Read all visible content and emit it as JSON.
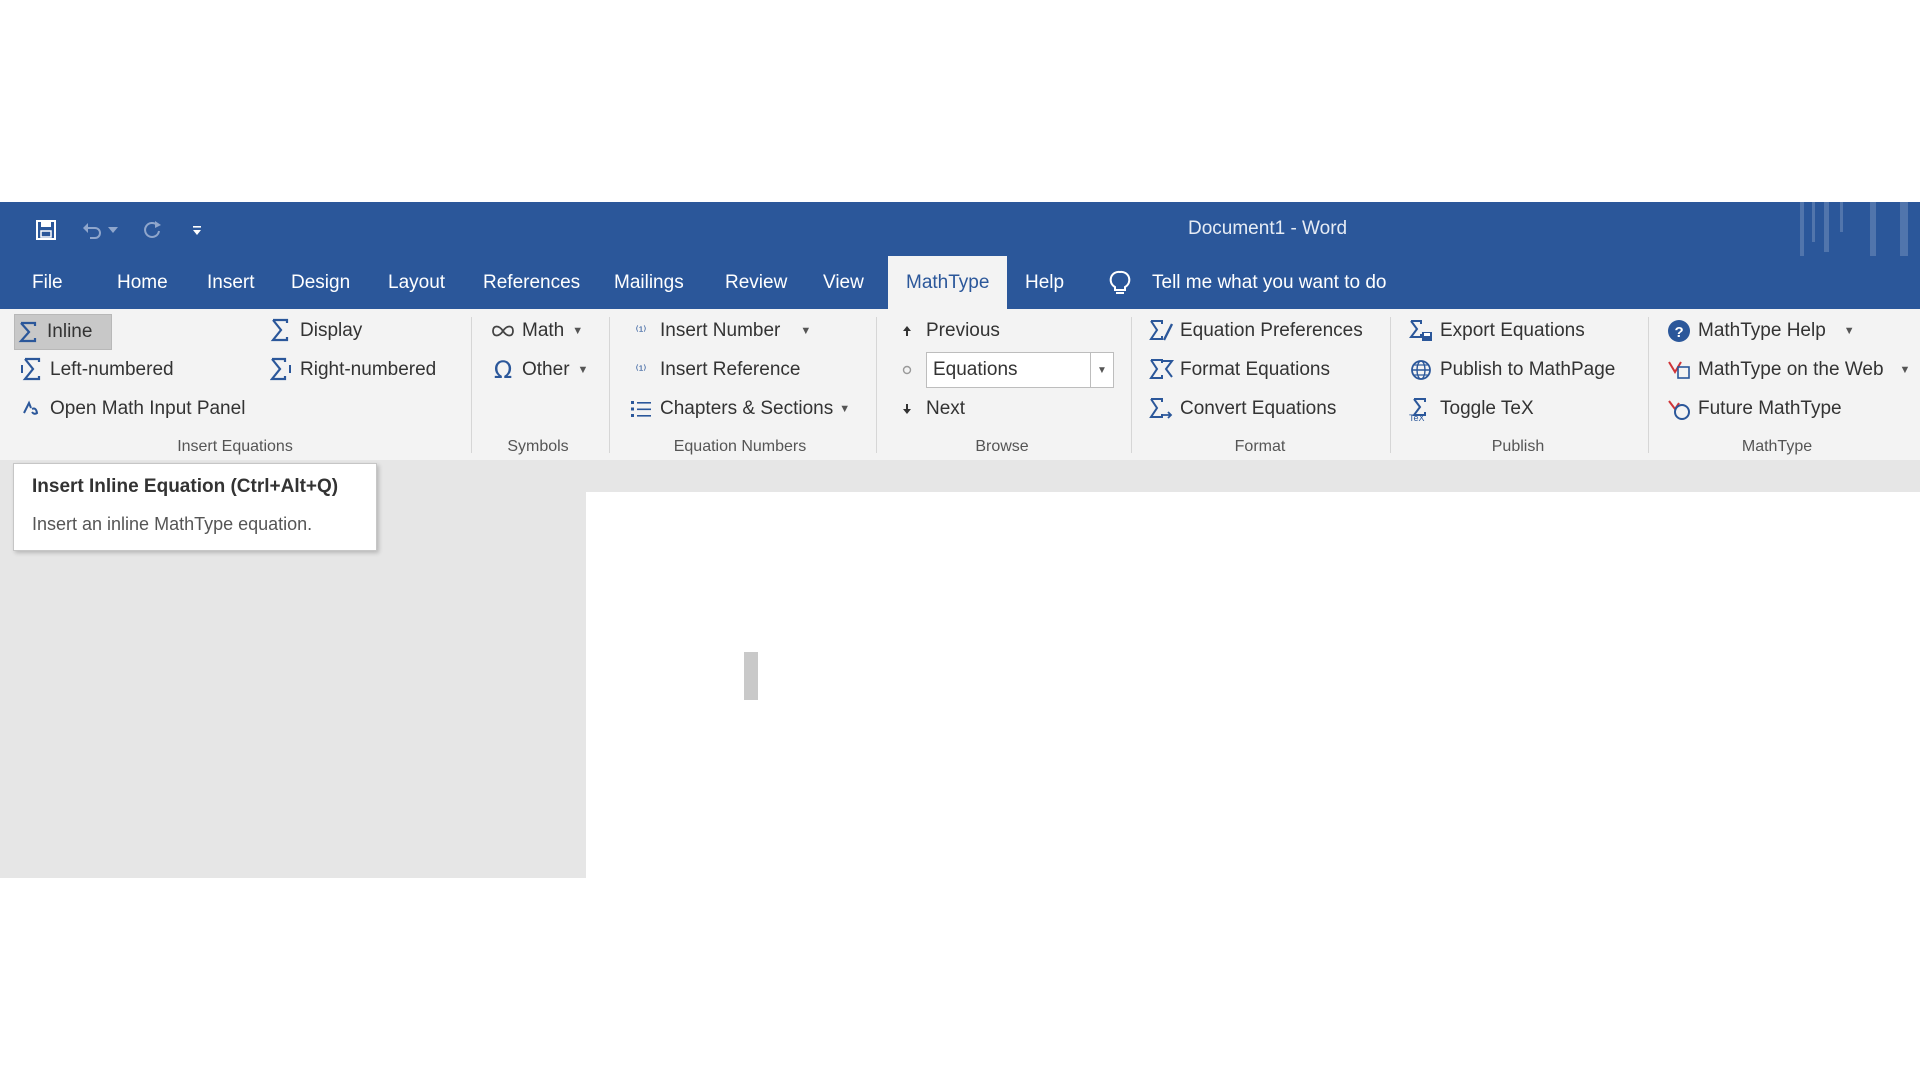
{
  "window": {
    "title": "Document1  -  Word",
    "quick_access": [
      "save-icon",
      "undo-icon",
      "redo-icon",
      "customize-icon"
    ]
  },
  "tabs": [
    "File",
    "Home",
    "Insert",
    "Design",
    "Layout",
    "References",
    "Mailings",
    "Review",
    "View",
    "MathType",
    "Help"
  ],
  "active_tab": "MathType",
  "tell_me": "Tell me what you want to do",
  "ribbon": {
    "insert_equations": {
      "label": "Insert Equations",
      "inline": "Inline",
      "display": "Display",
      "left_numbered": "Left-numbered",
      "right_numbered": "Right-numbered",
      "open_panel": "Open Math Input Panel"
    },
    "symbols": {
      "label": "Symbols",
      "math": "Math",
      "other": "Other"
    },
    "equation_numbers": {
      "label": "Equation Numbers",
      "insert_number": "Insert Number",
      "insert_reference": "Insert Reference",
      "chapters_sections": "Chapters & Sections"
    },
    "browse": {
      "label": "Browse",
      "previous": "Previous",
      "selection": "Equations",
      "next": "Next"
    },
    "format": {
      "label": "Format",
      "preferences": "Equation Preferences",
      "format_equations": "Format Equations",
      "convert": "Convert Equations"
    },
    "publish": {
      "label": "Publish",
      "export": "Export Equations",
      "publish_mathpage": "Publish to MathPage",
      "toggle_tex": "Toggle TeX"
    },
    "mathtype": {
      "label": "MathType",
      "help": "MathType Help",
      "web": "MathType on the Web",
      "future": "Future MathType"
    }
  },
  "tooltip": {
    "title": "Insert Inline Equation (Ctrl+Alt+Q)",
    "description": "Insert an inline MathType equation."
  },
  "colors": {
    "titlebar": "#2b579a",
    "ribbon": "#f3f3f3",
    "workarea": "#e6e6e6",
    "accent_blue": "#2b579a"
  }
}
